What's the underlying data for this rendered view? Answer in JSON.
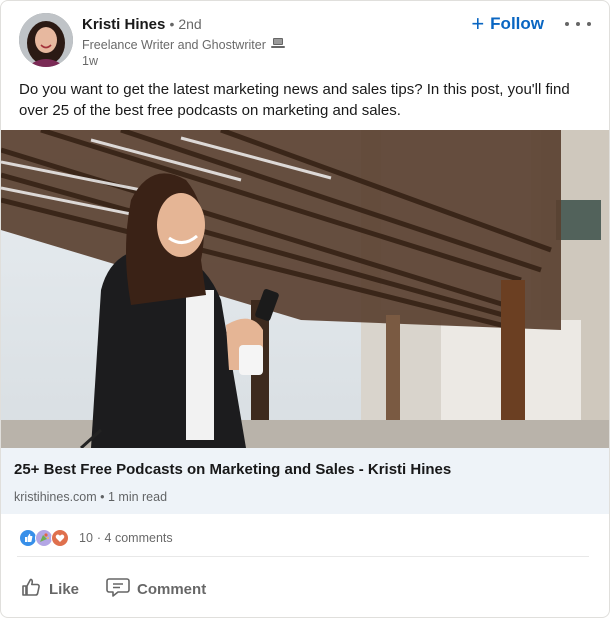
{
  "author": {
    "name": "Kristi Hines",
    "degree": "• 2nd",
    "headline": "Freelance Writer and Ghostwriter",
    "time": "1w"
  },
  "follow_label": "Follow",
  "post": {
    "text": "Do you want to get the latest marketing news and sales tips? In this post, you'll find over 25 of the best free podcasts on marketing and sales."
  },
  "link": {
    "title": "25+ Best Free Podcasts on Marketing and Sales - Kristi Hines",
    "subtitle": "kristihines.com • 1 min read"
  },
  "social": {
    "reaction_count": "10",
    "comments": "· 4 comments"
  },
  "actions": {
    "like": "Like",
    "comment": "Comment"
  },
  "colors": {
    "accent": "#0a66c2",
    "link_bg": "#eef3f8"
  },
  "icons": [
    "laptop-icon",
    "plus-icon",
    "more-icon",
    "like-reaction-icon",
    "celebrate-reaction-icon",
    "love-reaction-icon",
    "thumb-up-icon",
    "comment-icon"
  ]
}
